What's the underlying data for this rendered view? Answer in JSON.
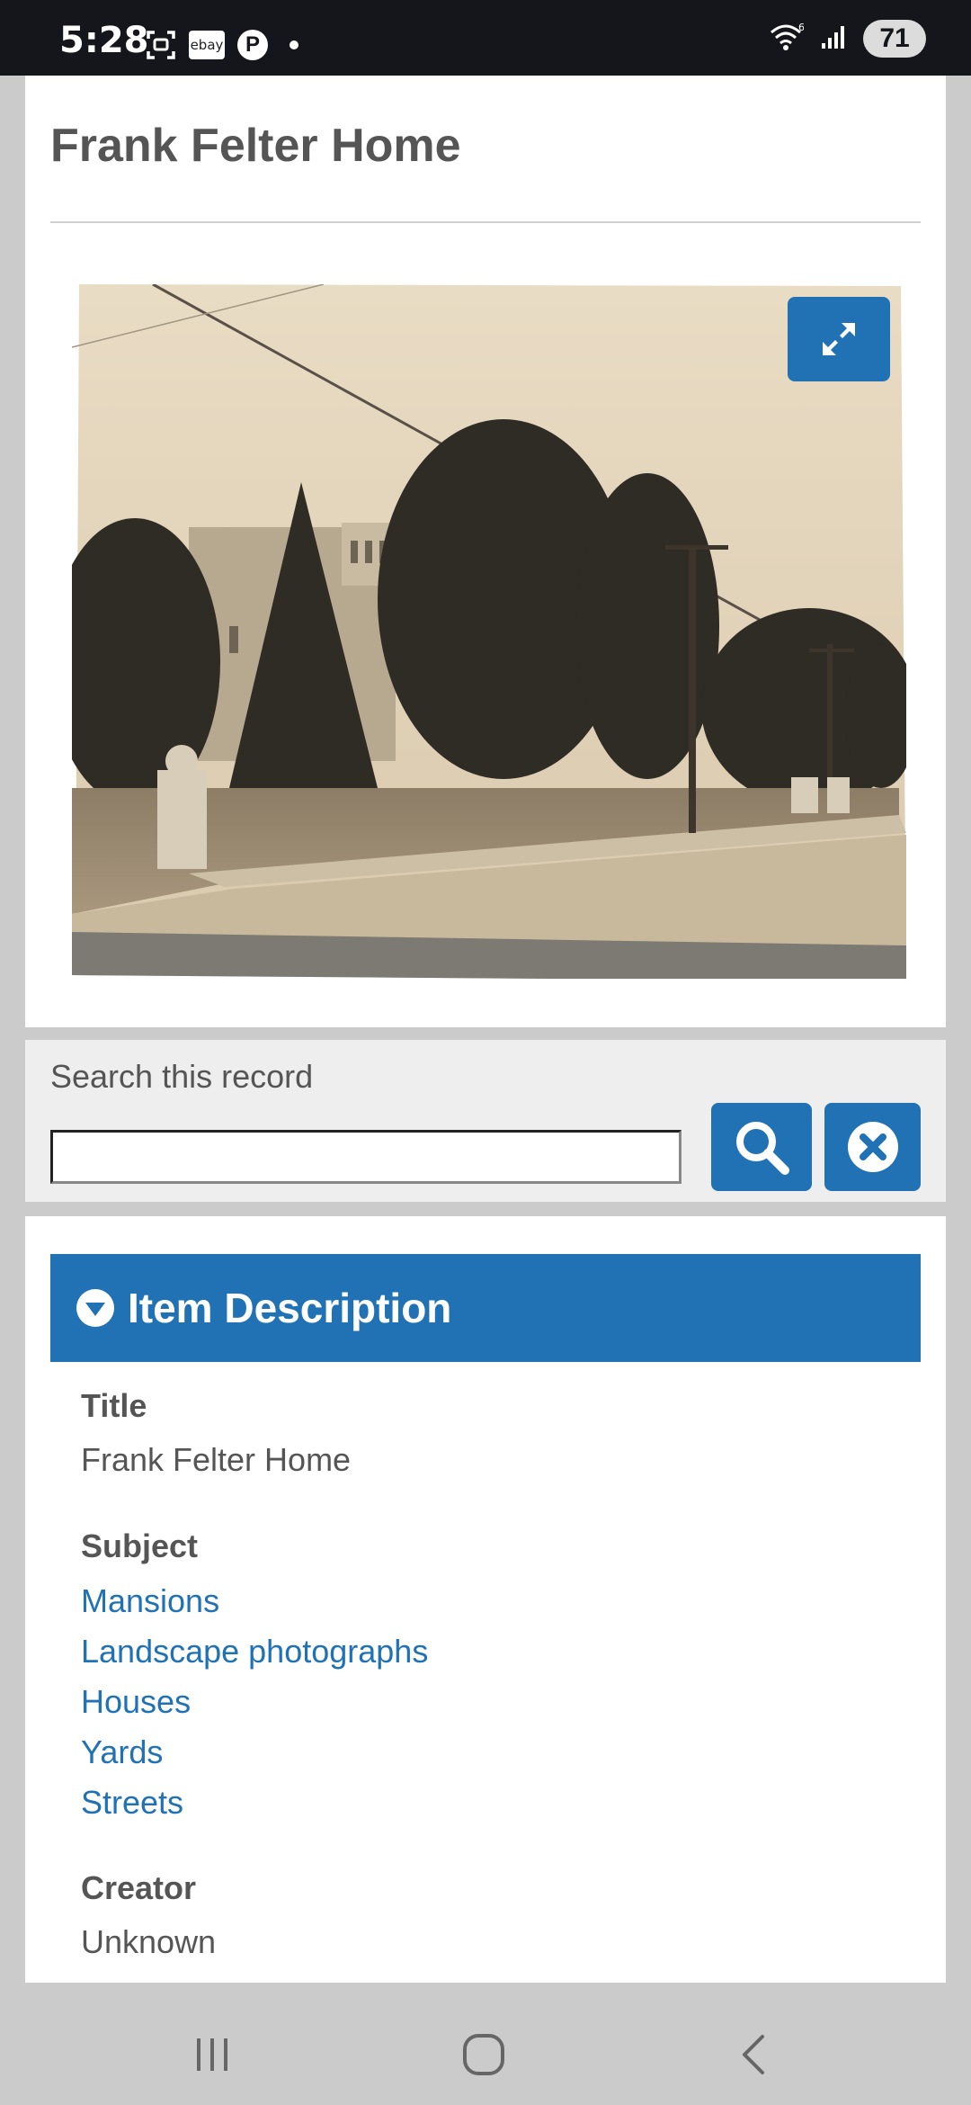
{
  "status_bar": {
    "time": "5:28",
    "ebay_label": "ebay",
    "parking_label": "P",
    "battery": "71",
    "icons": [
      "screenshot-icon",
      "ebay-icon",
      "parking-icon",
      "notification-dot-icon",
      "wifi-icon",
      "signal-icon",
      "battery-icon"
    ]
  },
  "page": {
    "title": "Frank Felter Home",
    "image_alt": "Frank Felter Home photograph",
    "expand_icon": "expand-icon"
  },
  "search": {
    "label": "Search this record",
    "value": "",
    "search_icon": "search-icon",
    "clear_icon": "clear-icon"
  },
  "item_description": {
    "header": "Item Description",
    "fields": {
      "title_label": "Title",
      "title_value": "Frank Felter Home",
      "subject_label": "Subject",
      "subjects": [
        "Mansions",
        "Landscape photographs",
        "Houses",
        "Yards",
        "Streets"
      ],
      "creator_label": "Creator",
      "creator_value": "Unknown"
    }
  },
  "colors": {
    "accent": "#2072b5",
    "status_bar": "#15161b",
    "background": "#cbcbcb"
  },
  "nav": {
    "icons": [
      "recent-apps-icon",
      "home-icon",
      "back-icon"
    ]
  }
}
